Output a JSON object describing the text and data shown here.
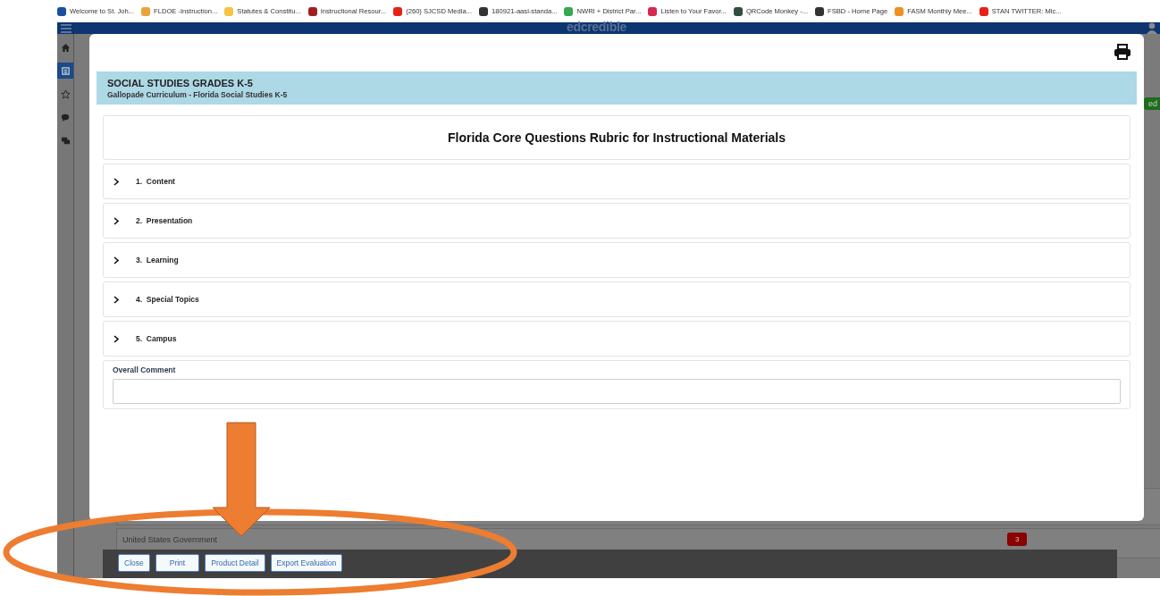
{
  "bookmarks": [
    {
      "label": "Welcome to St. Joh...",
      "color": "#1a4fa0"
    },
    {
      "label": "FLDOE -Instruction...",
      "color": "#e8a33d"
    },
    {
      "label": "Statutes & Constitu...",
      "color": "#f5c542"
    },
    {
      "label": "Instructional Resour...",
      "color": "#a02020"
    },
    {
      "label": "(260) SJCSD Media...",
      "color": "#e62117"
    },
    {
      "label": "180921-aasl-standa...",
      "color": "#333333"
    },
    {
      "label": "NWRI + District Par...",
      "color": "#34a853"
    },
    {
      "label": "Listen to Your Favor...",
      "color": "#d8274a"
    },
    {
      "label": "QRCode Monkey -...",
      "color": "#2f4f3f"
    },
    {
      "label": "FSBD - Home Page",
      "color": "#333333"
    },
    {
      "label": "FASM Monthly Mee...",
      "color": "#f09020"
    },
    {
      "label": "STAN TWITTER: Mic...",
      "color": "#e62117"
    }
  ],
  "app": {
    "logo": "edcredible",
    "sidebar": [
      {
        "kind": "home",
        "selected": false
      },
      {
        "kind": "list",
        "selected": true
      },
      {
        "kind": "star",
        "selected": false
      },
      {
        "kind": "chat",
        "selected": false
      },
      {
        "kind": "chats",
        "selected": false
      }
    ],
    "status_badge": "ed",
    "background_row": {
      "title": "United States Government",
      "badge": "3"
    }
  },
  "modal": {
    "header": {
      "title": "SOCIAL STUDIES GRADES K-5",
      "subtitle": "Gallopade Curriculum - Florida Social Studies K-5"
    },
    "rubric_title": "Florida Core Questions Rubric for Instructional Materials",
    "sections": [
      {
        "number": "1.",
        "label": "Content",
        "expanded": false
      },
      {
        "number": "2.",
        "label": "Presentation",
        "expanded": false
      },
      {
        "number": "3.",
        "label": "Learning",
        "expanded": false
      },
      {
        "number": "4.",
        "label": "Special Topics",
        "expanded": false
      },
      {
        "number": "5.",
        "label": "Campus",
        "expanded": false
      }
    ],
    "overall_comment": {
      "label": "Overall Comment"
    }
  },
  "footer_buttons": [
    "Close",
    "Print",
    "Product Detail",
    "Export Evaluation"
  ]
}
